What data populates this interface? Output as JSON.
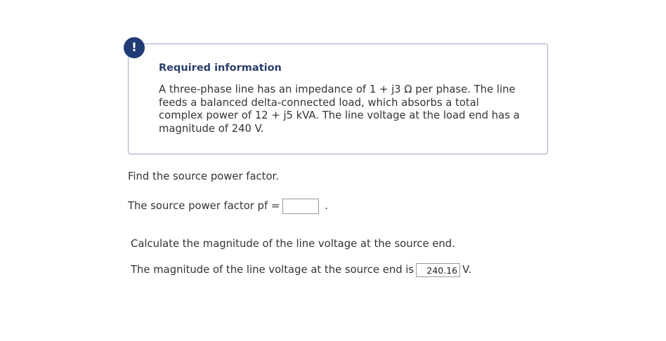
{
  "required_info": {
    "badge": "!",
    "title": "Required information",
    "lines": [
      "A three-phase line has an impedance of 1 + j3 Ω per phase. The line",
      "feeds a balanced delta-connected load, which absorbs a total",
      "complex power of 12 + j5 kVA. The line voltage at the load end has a",
      "magnitude of 240 V."
    ]
  },
  "part1": {
    "question": "Find the source power factor.",
    "answer_prefix": "The source power factor pf =",
    "answer_value": "",
    "answer_suffix": "."
  },
  "part2": {
    "question": "Calculate the magnitude of the line voltage at the source end.",
    "answer_prefix": "The magnitude of the line voltage at the source end is",
    "answer_value": "240.16",
    "answer_suffix": "V."
  },
  "colors": {
    "badge_bg": "#1f3a75",
    "title_color": "#2b3f6e",
    "box_border": "#9aa8c0",
    "text": "#333333"
  }
}
